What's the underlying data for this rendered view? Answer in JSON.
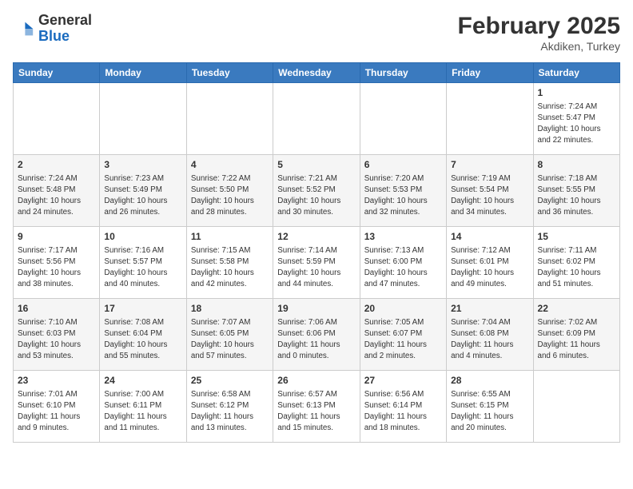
{
  "header": {
    "logo_general": "General",
    "logo_blue": "Blue",
    "month_year": "February 2025",
    "location": "Akdiken, Turkey"
  },
  "days_of_week": [
    "Sunday",
    "Monday",
    "Tuesday",
    "Wednesday",
    "Thursday",
    "Friday",
    "Saturday"
  ],
  "weeks": [
    [
      {
        "day": "",
        "info": ""
      },
      {
        "day": "",
        "info": ""
      },
      {
        "day": "",
        "info": ""
      },
      {
        "day": "",
        "info": ""
      },
      {
        "day": "",
        "info": ""
      },
      {
        "day": "",
        "info": ""
      },
      {
        "day": "1",
        "info": "Sunrise: 7:24 AM\nSunset: 5:47 PM\nDaylight: 10 hours\nand 22 minutes."
      }
    ],
    [
      {
        "day": "2",
        "info": "Sunrise: 7:24 AM\nSunset: 5:48 PM\nDaylight: 10 hours\nand 24 minutes."
      },
      {
        "day": "3",
        "info": "Sunrise: 7:23 AM\nSunset: 5:49 PM\nDaylight: 10 hours\nand 26 minutes."
      },
      {
        "day": "4",
        "info": "Sunrise: 7:22 AM\nSunset: 5:50 PM\nDaylight: 10 hours\nand 28 minutes."
      },
      {
        "day": "5",
        "info": "Sunrise: 7:21 AM\nSunset: 5:52 PM\nDaylight: 10 hours\nand 30 minutes."
      },
      {
        "day": "6",
        "info": "Sunrise: 7:20 AM\nSunset: 5:53 PM\nDaylight: 10 hours\nand 32 minutes."
      },
      {
        "day": "7",
        "info": "Sunrise: 7:19 AM\nSunset: 5:54 PM\nDaylight: 10 hours\nand 34 minutes."
      },
      {
        "day": "8",
        "info": "Sunrise: 7:18 AM\nSunset: 5:55 PM\nDaylight: 10 hours\nand 36 minutes."
      }
    ],
    [
      {
        "day": "9",
        "info": "Sunrise: 7:17 AM\nSunset: 5:56 PM\nDaylight: 10 hours\nand 38 minutes."
      },
      {
        "day": "10",
        "info": "Sunrise: 7:16 AM\nSunset: 5:57 PM\nDaylight: 10 hours\nand 40 minutes."
      },
      {
        "day": "11",
        "info": "Sunrise: 7:15 AM\nSunset: 5:58 PM\nDaylight: 10 hours\nand 42 minutes."
      },
      {
        "day": "12",
        "info": "Sunrise: 7:14 AM\nSunset: 5:59 PM\nDaylight: 10 hours\nand 44 minutes."
      },
      {
        "day": "13",
        "info": "Sunrise: 7:13 AM\nSunset: 6:00 PM\nDaylight: 10 hours\nand 47 minutes."
      },
      {
        "day": "14",
        "info": "Sunrise: 7:12 AM\nSunset: 6:01 PM\nDaylight: 10 hours\nand 49 minutes."
      },
      {
        "day": "15",
        "info": "Sunrise: 7:11 AM\nSunset: 6:02 PM\nDaylight: 10 hours\nand 51 minutes."
      }
    ],
    [
      {
        "day": "16",
        "info": "Sunrise: 7:10 AM\nSunset: 6:03 PM\nDaylight: 10 hours\nand 53 minutes."
      },
      {
        "day": "17",
        "info": "Sunrise: 7:08 AM\nSunset: 6:04 PM\nDaylight: 10 hours\nand 55 minutes."
      },
      {
        "day": "18",
        "info": "Sunrise: 7:07 AM\nSunset: 6:05 PM\nDaylight: 10 hours\nand 57 minutes."
      },
      {
        "day": "19",
        "info": "Sunrise: 7:06 AM\nSunset: 6:06 PM\nDaylight: 11 hours\nand 0 minutes."
      },
      {
        "day": "20",
        "info": "Sunrise: 7:05 AM\nSunset: 6:07 PM\nDaylight: 11 hours\nand 2 minutes."
      },
      {
        "day": "21",
        "info": "Sunrise: 7:04 AM\nSunset: 6:08 PM\nDaylight: 11 hours\nand 4 minutes."
      },
      {
        "day": "22",
        "info": "Sunrise: 7:02 AM\nSunset: 6:09 PM\nDaylight: 11 hours\nand 6 minutes."
      }
    ],
    [
      {
        "day": "23",
        "info": "Sunrise: 7:01 AM\nSunset: 6:10 PM\nDaylight: 11 hours\nand 9 minutes."
      },
      {
        "day": "24",
        "info": "Sunrise: 7:00 AM\nSunset: 6:11 PM\nDaylight: 11 hours\nand 11 minutes."
      },
      {
        "day": "25",
        "info": "Sunrise: 6:58 AM\nSunset: 6:12 PM\nDaylight: 11 hours\nand 13 minutes."
      },
      {
        "day": "26",
        "info": "Sunrise: 6:57 AM\nSunset: 6:13 PM\nDaylight: 11 hours\nand 15 minutes."
      },
      {
        "day": "27",
        "info": "Sunrise: 6:56 AM\nSunset: 6:14 PM\nDaylight: 11 hours\nand 18 minutes."
      },
      {
        "day": "28",
        "info": "Sunrise: 6:55 AM\nSunset: 6:15 PM\nDaylight: 11 hours\nand 20 minutes."
      },
      {
        "day": "",
        "info": ""
      }
    ]
  ]
}
